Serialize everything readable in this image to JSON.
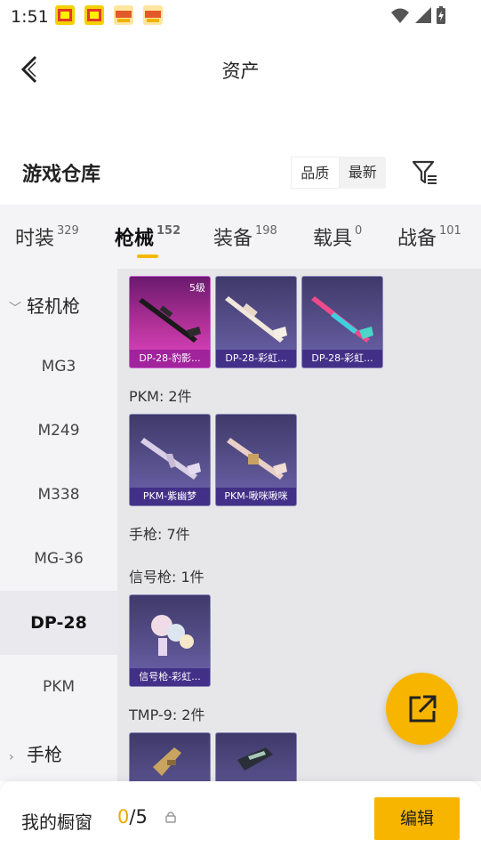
{
  "status": {
    "time": "1:51"
  },
  "header": {
    "title": "资产"
  },
  "warehouse": {
    "title": "游戏仓库",
    "sort": [
      "品质",
      "最新"
    ]
  },
  "tabs": [
    {
      "label": "时装",
      "count": "329"
    },
    {
      "label": "枪械",
      "count": "152"
    },
    {
      "label": "装备",
      "count": "198"
    },
    {
      "label": "载具",
      "count": "0"
    },
    {
      "label": "战备",
      "count": "101"
    }
  ],
  "sidebar": {
    "group1": "轻机枪",
    "items": [
      "MG3",
      "M249",
      "M338",
      "MG-36",
      "DP-28",
      "PKM"
    ],
    "group2": "手枪"
  },
  "sections": {
    "pkm": "PKM: 2件",
    "pistol": "手枪: 7件",
    "flare": "信号枪: 1件",
    "tmp9": "TMP-9: 2件"
  },
  "cards": {
    "dp28_1": {
      "caption": "DP-28-豹影...",
      "level": "5级"
    },
    "dp28_2": {
      "caption": "DP-28-彩虹..."
    },
    "dp28_3": {
      "caption": "DP-28-彩虹..."
    },
    "pkm_1": {
      "caption": "PKM-紫幽梦"
    },
    "pkm_2": {
      "caption": "PKM-啾咪啾咪"
    },
    "flare_1": {
      "caption": "信号枪-彩虹..."
    }
  },
  "bottom": {
    "label": "我的橱窗",
    "current": "0",
    "sep": "/",
    "max": "5",
    "edit": "编辑"
  },
  "colors": {
    "accent": "#f7b500",
    "cardPurple": "#5a5390",
    "cardPink": "#b4329a"
  }
}
